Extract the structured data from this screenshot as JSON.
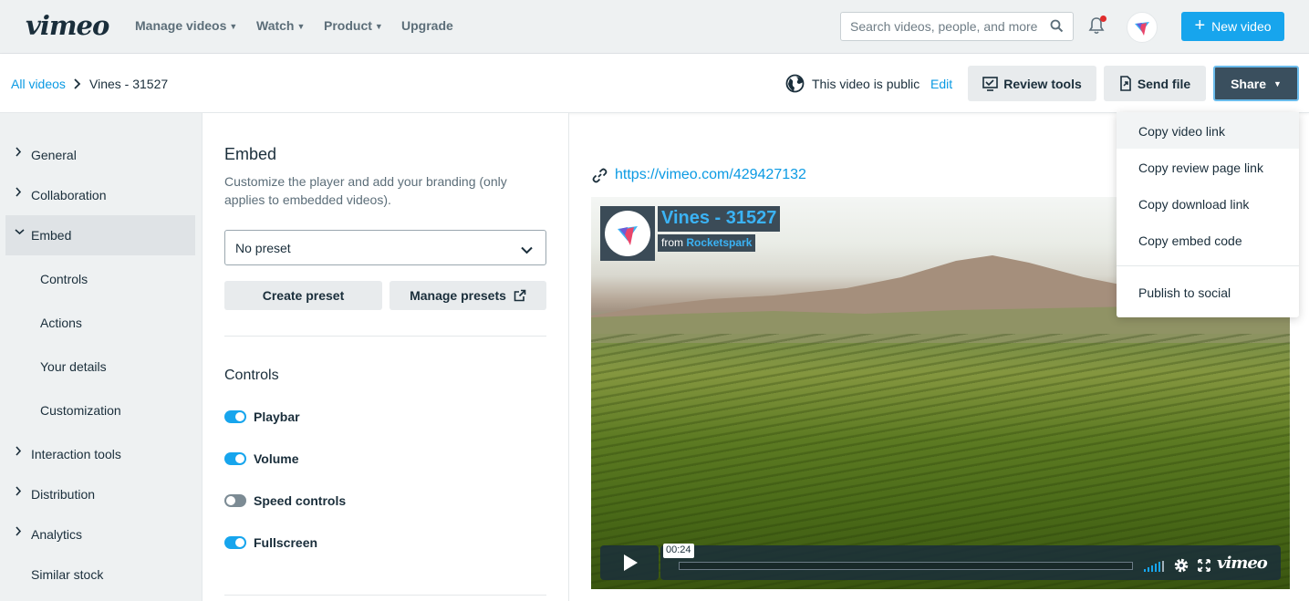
{
  "topnav": {
    "logo": "vimeo",
    "links": [
      "Manage videos",
      "Watch",
      "Product",
      "Upgrade"
    ],
    "search_placeholder": "Search videos, people, and more",
    "new_video": "New video"
  },
  "subheader": {
    "breadcrumb_root": "All videos",
    "breadcrumb_sep": "›",
    "breadcrumb_current": "Vines - 31527",
    "privacy_text": "This video is public",
    "privacy_edit": "Edit",
    "review_tools": "Review tools",
    "send_file": "Send file",
    "share": "Share"
  },
  "sidebar": {
    "items": [
      {
        "label": "General",
        "arrow": "›"
      },
      {
        "label": "Collaboration",
        "arrow": "›"
      },
      {
        "label": "Embed",
        "arrow": "⌄"
      },
      {
        "label": "Controls"
      },
      {
        "label": "Actions"
      },
      {
        "label": "Your details"
      },
      {
        "label": "Customization"
      },
      {
        "label": "Interaction tools",
        "arrow": "›"
      },
      {
        "label": "Distribution",
        "arrow": "›"
      },
      {
        "label": "Analytics",
        "arrow": "›"
      },
      {
        "label": "Similar stock"
      }
    ]
  },
  "panel": {
    "title": "Embed",
    "description": "Customize the player and add your branding (only applies to embedded videos).",
    "preset_value": "No preset",
    "create_preset": "Create preset",
    "manage_presets": "Manage presets",
    "controls_title": "Controls",
    "toggles": [
      {
        "label": "Playbar",
        "on": true
      },
      {
        "label": "Volume",
        "on": true
      },
      {
        "label": "Speed controls",
        "on": false
      },
      {
        "label": "Fullscreen",
        "on": true
      }
    ]
  },
  "video": {
    "url": "https://vimeo.com/429427132",
    "title": "Vines - 31527",
    "from_label": "from",
    "from_user": "Rocketspark",
    "timecode": "00:24",
    "player_logo": "vimeo"
  },
  "share_menu": {
    "items": [
      "Copy video link",
      "Copy review page link",
      "Copy download link",
      "Copy embed code",
      "Publish to social"
    ]
  },
  "colors": {
    "accent": "#17a5ed",
    "link": "#0b9ae3",
    "dark": "#1a2e3b",
    "share_bg": "#3a4f5e"
  }
}
